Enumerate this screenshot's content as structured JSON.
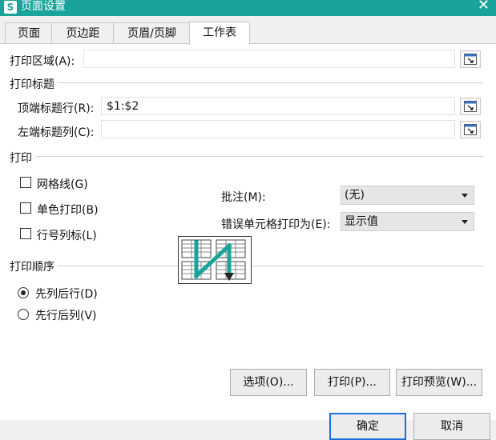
{
  "window": {
    "title": "页面设置",
    "app_icon": "S"
  },
  "tabs": [
    {
      "label": "页面"
    },
    {
      "label": "页边距"
    },
    {
      "label": "页眉/页脚"
    },
    {
      "label": "工作表"
    }
  ],
  "print_area": {
    "label": "打印区域(A):",
    "value": ""
  },
  "print_titles": {
    "group": "打印标题",
    "top_rows_label": "顶端标题行(R):",
    "top_rows_value": "$1:$2",
    "left_cols_label": "左端标题列(C):",
    "left_cols_value": ""
  },
  "print": {
    "group": "打印",
    "gridlines": "网格线(G)",
    "mono": "单色打印(B)",
    "headings": "行号列标(L)",
    "comments_label": "批注(M):",
    "comments_value": "(无)",
    "errors_label": "错误单元格打印为(E):",
    "errors_value": "显示值"
  },
  "print_order": {
    "group": "打印顺序",
    "down_then_over": "先列后行(D)",
    "over_then_down": "先行后列(V)"
  },
  "buttons": {
    "options": "选项(O)...",
    "print": "打印(P)...",
    "preview": "打印预览(W)...",
    "ok": "确定",
    "cancel": "取消"
  },
  "icons": {
    "range_picker": "range-picker-icon",
    "order_diagram": "page-order-diagram-icon",
    "accent": "#1aa39b"
  }
}
